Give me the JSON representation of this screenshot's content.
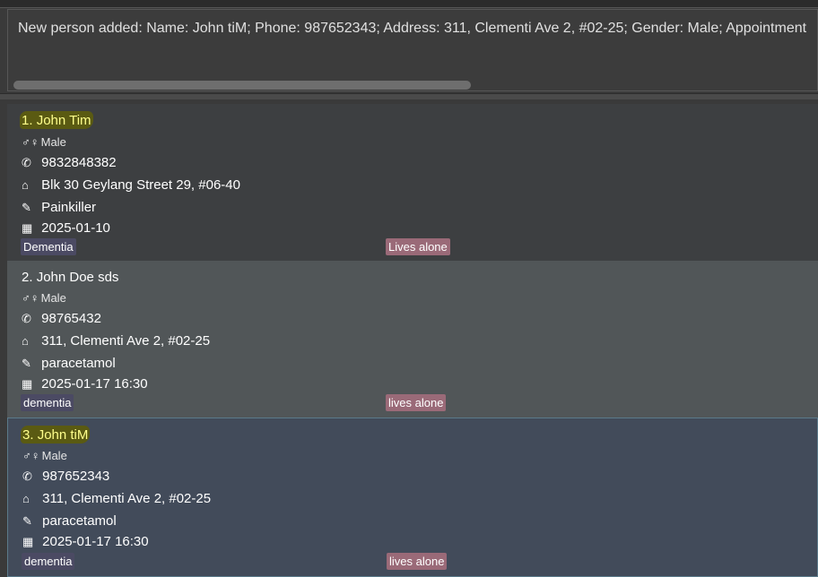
{
  "result": {
    "message": "New person added: Name: John tiM; Phone: 987652343; Address: 311, Clementi Ave 2, #02-25; Gender: Male; Appointment"
  },
  "icons": {
    "gender": "♂♀",
    "phone": "✆",
    "address": "⌂",
    "medicine": "✎",
    "calendar": "▦"
  },
  "persons": [
    {
      "index": "1.",
      "name": "John Tim",
      "gender": "Male",
      "phone": "9832848382",
      "address": "Blk 30 Geylang Street 29, #06-40",
      "medicine": "Painkiller",
      "appointment": "2025-01-10",
      "tags": [
        "Dementia",
        "Lives alone"
      ]
    },
    {
      "index": "2.",
      "name": "John Doe sds",
      "gender": "Male",
      "phone": "98765432",
      "address": "311, Clementi Ave 2, #02-25",
      "medicine": "paracetamol",
      "appointment": "2025-01-17 16:30",
      "tags": [
        "dementia",
        "lives alone"
      ]
    },
    {
      "index": "3.",
      "name": "John tiM",
      "gender": "Male",
      "phone": "987652343",
      "address": "311, Clementi Ave 2, #02-25",
      "medicine": "paracetamol",
      "appointment": "2025-01-17 16:30",
      "tags": [
        "dementia",
        "lives alone"
      ]
    }
  ]
}
